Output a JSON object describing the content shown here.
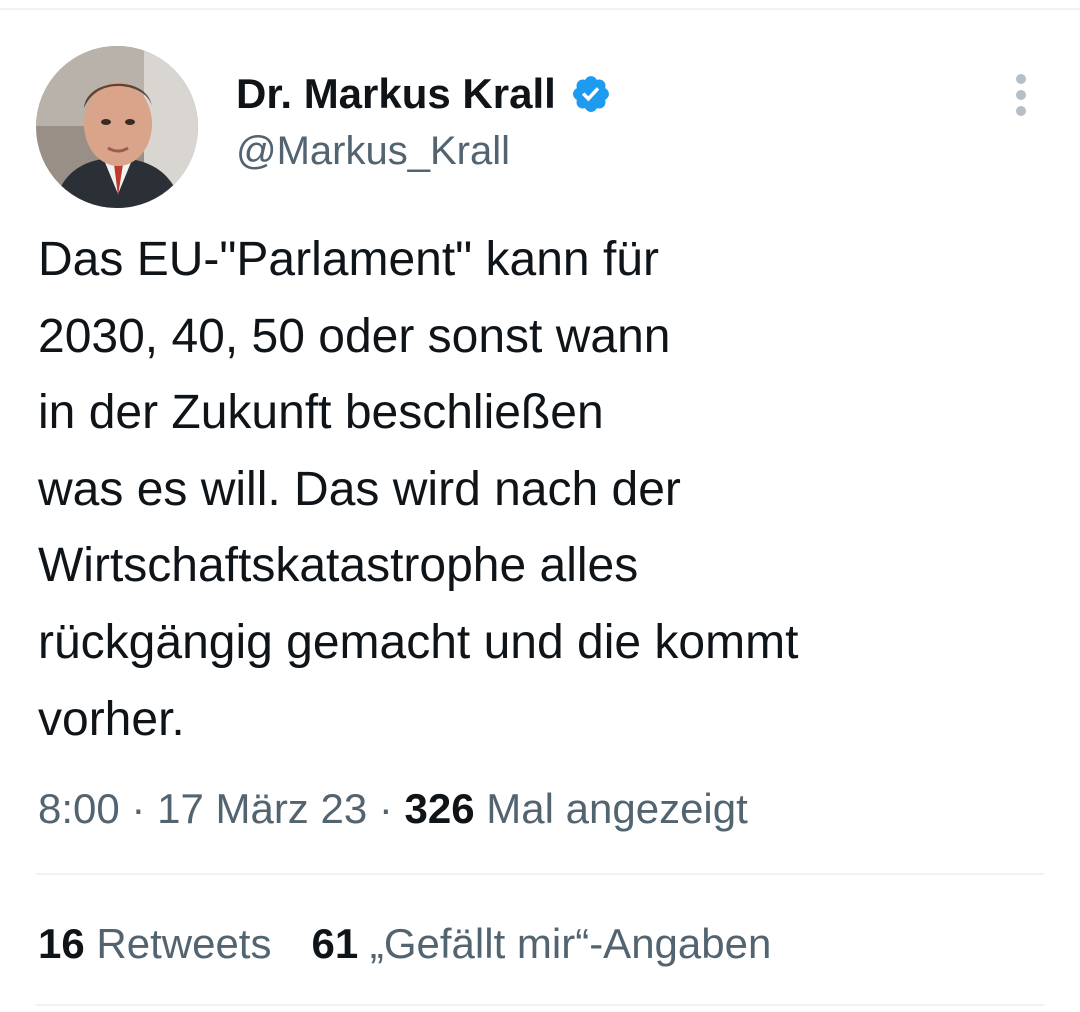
{
  "tweet": {
    "author": {
      "display_name": "Dr. Markus Krall",
      "handle": "@Markus_Krall",
      "verified_icon": "verified-badge-icon",
      "avatar_alt": "profile photo"
    },
    "more_icon": "more-vertical-icon",
    "text_lines": [
      "Das EU-\"Parlament\" kann für",
      "2030, 40, 50 oder sonst wann",
      "in der Zukunft beschließen",
      "was es will. Das wird nach der",
      "Wirtschaftskatastrophe alles",
      "rückgängig gemacht und die kommt",
      "vorher."
    ],
    "meta": {
      "time": "8:00",
      "separator": "·",
      "date": "17 März 23",
      "views_count": "326",
      "views_label": "Mal angezeigt"
    },
    "stats": {
      "retweets_count": "16",
      "retweets_label": "Retweets",
      "likes_count": "61",
      "likes_label": "„Gefällt mir“-Angaben"
    }
  },
  "colors": {
    "text": "#0f1419",
    "secondary": "#536471",
    "verified": "#1d9bf0",
    "divider": "#eff3f4"
  }
}
